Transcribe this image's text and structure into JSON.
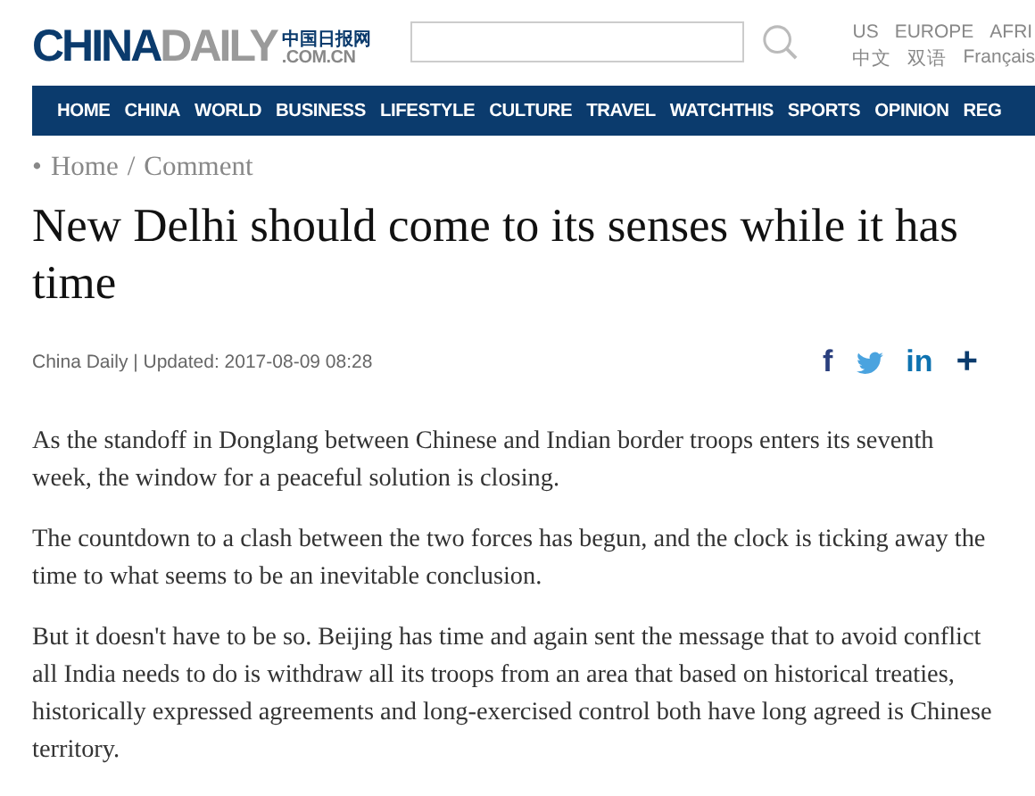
{
  "header": {
    "logo": {
      "primary": "CHINA",
      "secondary": "DAILY",
      "chinese": "中国日报网",
      "domain": ".COM.CN"
    },
    "editions": [
      "US",
      "EUROPE",
      "AFRI"
    ],
    "languages": [
      "中文",
      "双语",
      "Français"
    ]
  },
  "nav": [
    {
      "label": "HOME"
    },
    {
      "label": "CHINA"
    },
    {
      "label": "WORLD"
    },
    {
      "label": "BUSINESS"
    },
    {
      "label": "LIFESTYLE"
    },
    {
      "label": "CULTURE"
    },
    {
      "label": "TRAVEL"
    },
    {
      "label": "WATCHTHIS"
    },
    {
      "label": "SPORTS"
    },
    {
      "label": "OPINION"
    },
    {
      "label": "REG"
    }
  ],
  "breadcrumb": {
    "bullet": "•",
    "items": [
      "Home",
      "Comment"
    ],
    "separator": "/"
  },
  "article": {
    "title": "New Delhi should come to its senses while it has time",
    "byline": "China Daily | Updated: 2017-08-09 08:28",
    "share": [
      {
        "kind": "facebook",
        "label": "f"
      },
      {
        "kind": "twitter"
      },
      {
        "kind": "linkedin",
        "label": "in"
      },
      {
        "kind": "more",
        "label": "+"
      }
    ],
    "paragraphs": [
      "As the standoff in Donglang between Chinese and Indian border troops enters its seventh week, the window for a peaceful solution is closing.",
      "The countdown to a clash between the two forces has begun, and the clock is ticking away the time to what seems to be an inevitable conclusion.",
      "But it doesn't have to be so. Beijing has time and again sent the message that to avoid conflict all India needs to do is withdraw all its troops from an area that based on historical treaties, historically expressed agreements and long-exercised control both have long agreed is Chinese territory."
    ]
  }
}
